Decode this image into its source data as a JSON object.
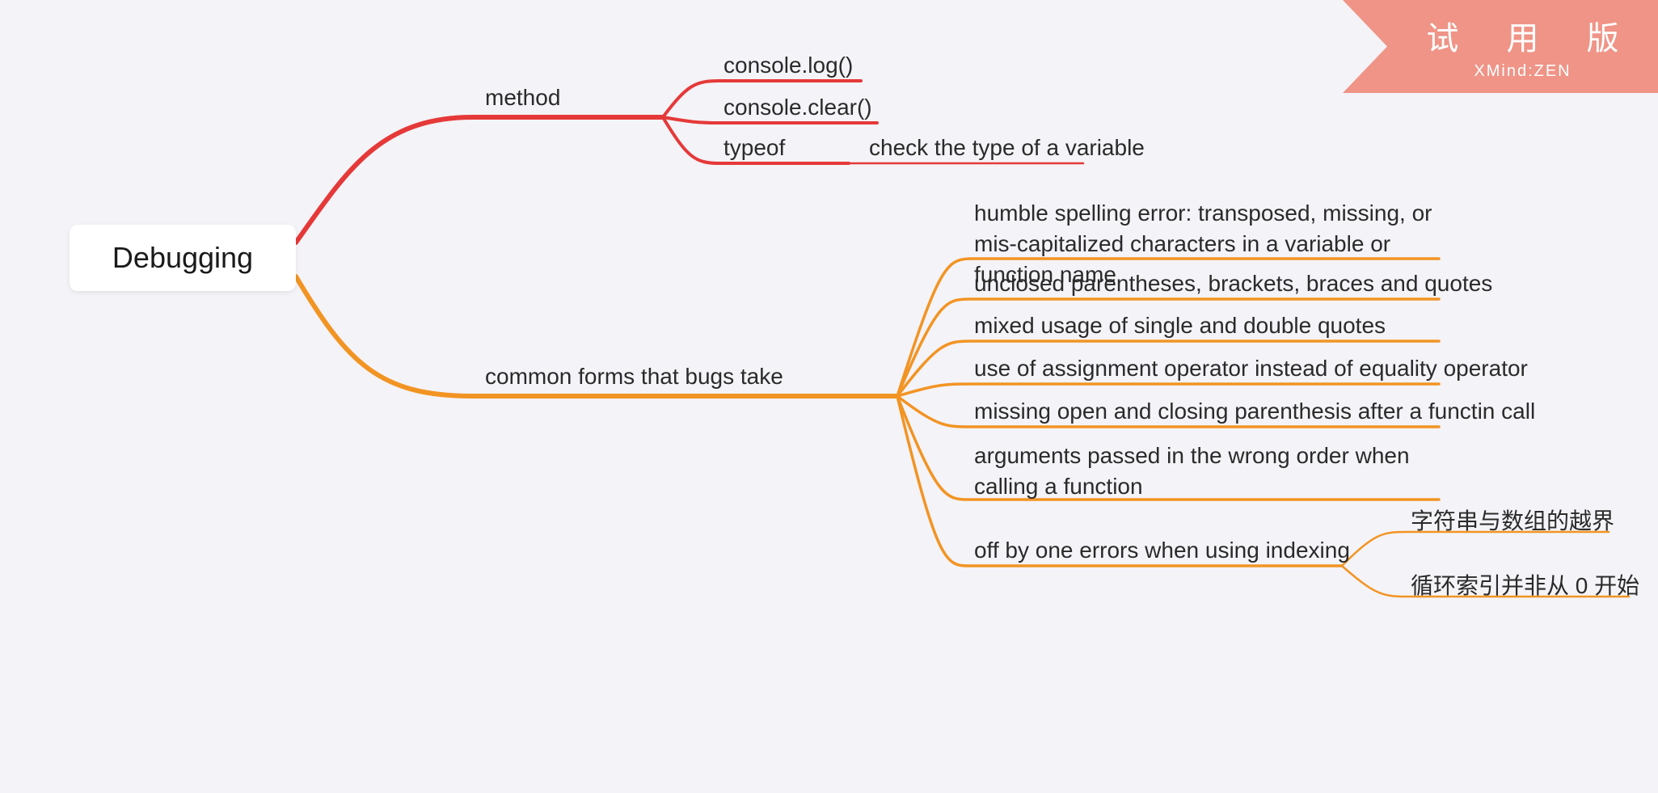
{
  "watermark": {
    "title": "试 用 版",
    "subtitle": "XMind:ZEN"
  },
  "root": {
    "label": "Debugging"
  },
  "branches": {
    "method": {
      "label": "method",
      "color": "#e53939",
      "children": [
        {
          "label": "console.log()"
        },
        {
          "label": "console.clear()"
        },
        {
          "label": "typeof",
          "children": [
            {
              "label": "check the type of a variable"
            }
          ]
        }
      ]
    },
    "common": {
      "label": "common forms that bugs take",
      "color": "#f29423",
      "children": [
        {
          "label": "humble spelling error: transposed, missing, or mis-capitalized characters in a variable or function name"
        },
        {
          "label": "unclosed parentheses, brackets, braces and quotes"
        },
        {
          "label": "mixed usage of single and double quotes"
        },
        {
          "label": "use of assignment operator instead of equality operator"
        },
        {
          "label": "missing open and closing parenthesis after a functin call"
        },
        {
          "label": "arguments passed in the wrong order when calling a function"
        },
        {
          "label": "off by one errors when using indexing",
          "children": [
            {
              "label": "字符串与数组的越界"
            },
            {
              "label": "循环索引并非从 0 开始"
            }
          ]
        }
      ]
    }
  }
}
